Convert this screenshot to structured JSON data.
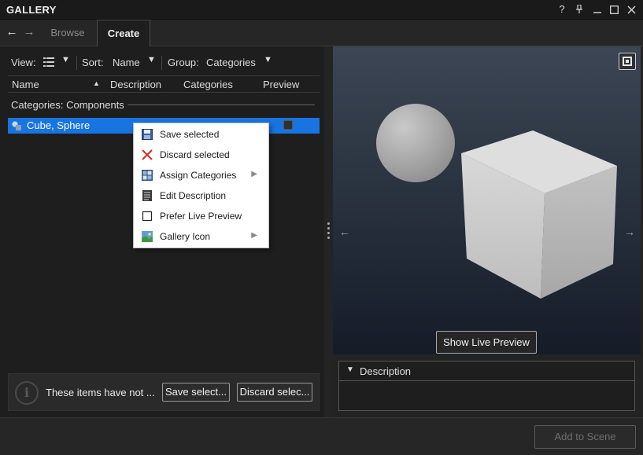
{
  "window": {
    "title": "GALLERY",
    "controls": {
      "help": "?",
      "pin": "⊥",
      "minimize": "—",
      "maximize": "□",
      "close": "✕"
    }
  },
  "nav": {
    "back": "←",
    "forward": "→"
  },
  "tabs": [
    {
      "label": "Browse",
      "active": false
    },
    {
      "label": "Create",
      "active": true
    }
  ],
  "toolbar": {
    "view_label": "View:",
    "sort_label": "Sort:",
    "sort_value": "Name",
    "group_label": "Group:",
    "group_value": "Categories"
  },
  "columns": [
    "Name",
    "Description",
    "Categories",
    "Preview"
  ],
  "group": {
    "label": "Categories: Components"
  },
  "items": [
    {
      "label": "Cube, Sphere",
      "selected": true
    }
  ],
  "context_menu": {
    "items": [
      {
        "label": "Save selected",
        "icon": "save-icon",
        "submenu": false
      },
      {
        "label": "Discard selected",
        "icon": "discard-icon",
        "submenu": false
      },
      {
        "label": "Assign Categories",
        "icon": "categories-icon",
        "submenu": true
      },
      {
        "label": "Edit Description",
        "icon": "edit-description-icon",
        "submenu": false
      },
      {
        "label": "Prefer Live Preview",
        "icon": "checkbox-icon",
        "submenu": false
      },
      {
        "label": "Gallery Icon",
        "icon": "image-icon",
        "submenu": true
      }
    ]
  },
  "info_bar": {
    "text": "These items have not ...",
    "save_button": "Save select...",
    "discard_button": "Discard selec..."
  },
  "preview": {
    "show_live_preview": "Show Live Preview",
    "prev": "←",
    "next": "→"
  },
  "description": {
    "header": "Description",
    "body": ""
  },
  "footer": {
    "add_to_scene": "Add to Scene"
  },
  "colors": {
    "selection": "#1874e0",
    "background": "#1e1e1e",
    "accent_red": "#d9302c"
  }
}
